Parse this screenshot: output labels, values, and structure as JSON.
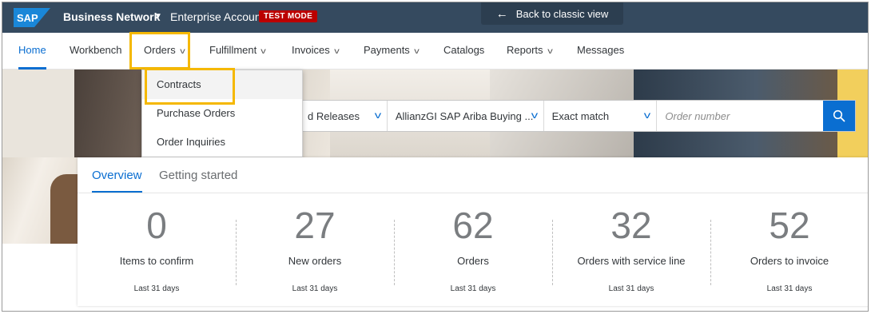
{
  "shell": {
    "logo": "SAP",
    "brand": "Business Network",
    "account": "Enterprise Account",
    "test_mode": "TEST MODE",
    "back_classic": "Back to classic view"
  },
  "nav": {
    "items": [
      {
        "label": "Home"
      },
      {
        "label": "Workbench"
      },
      {
        "label": "Orders"
      },
      {
        "label": "Fulfillment"
      },
      {
        "label": "Invoices"
      },
      {
        "label": "Payments"
      },
      {
        "label": "Catalogs"
      },
      {
        "label": "Reports"
      },
      {
        "label": "Messages"
      }
    ]
  },
  "orders_menu": {
    "items": [
      {
        "label": "Contracts"
      },
      {
        "label": "Purchase Orders"
      },
      {
        "label": "Order Inquiries"
      }
    ]
  },
  "search": {
    "doc_type": "d Releases",
    "buyer": "AllianzGI SAP Ariba Buying ...",
    "match": "Exact match",
    "placeholder": "Order number"
  },
  "overview": {
    "tabs": [
      {
        "label": "Overview"
      },
      {
        "label": "Getting started"
      }
    ],
    "stats": [
      {
        "value": "0",
        "label": "Items to confirm",
        "period": "Last 31 days"
      },
      {
        "value": "27",
        "label": "New orders",
        "period": "Last 31 days"
      },
      {
        "value": "62",
        "label": "Orders",
        "period": "Last 31 days"
      },
      {
        "value": "32",
        "label": "Orders with service line",
        "period": "Last 31 days"
      },
      {
        "value": "52",
        "label": "Orders to invoice",
        "period": "Last 31 days"
      }
    ]
  },
  "colors": {
    "shell": "#354a5f",
    "accent": "#0a6ed1",
    "highlight": "#f5b800",
    "test_mode": "#bb0000"
  }
}
